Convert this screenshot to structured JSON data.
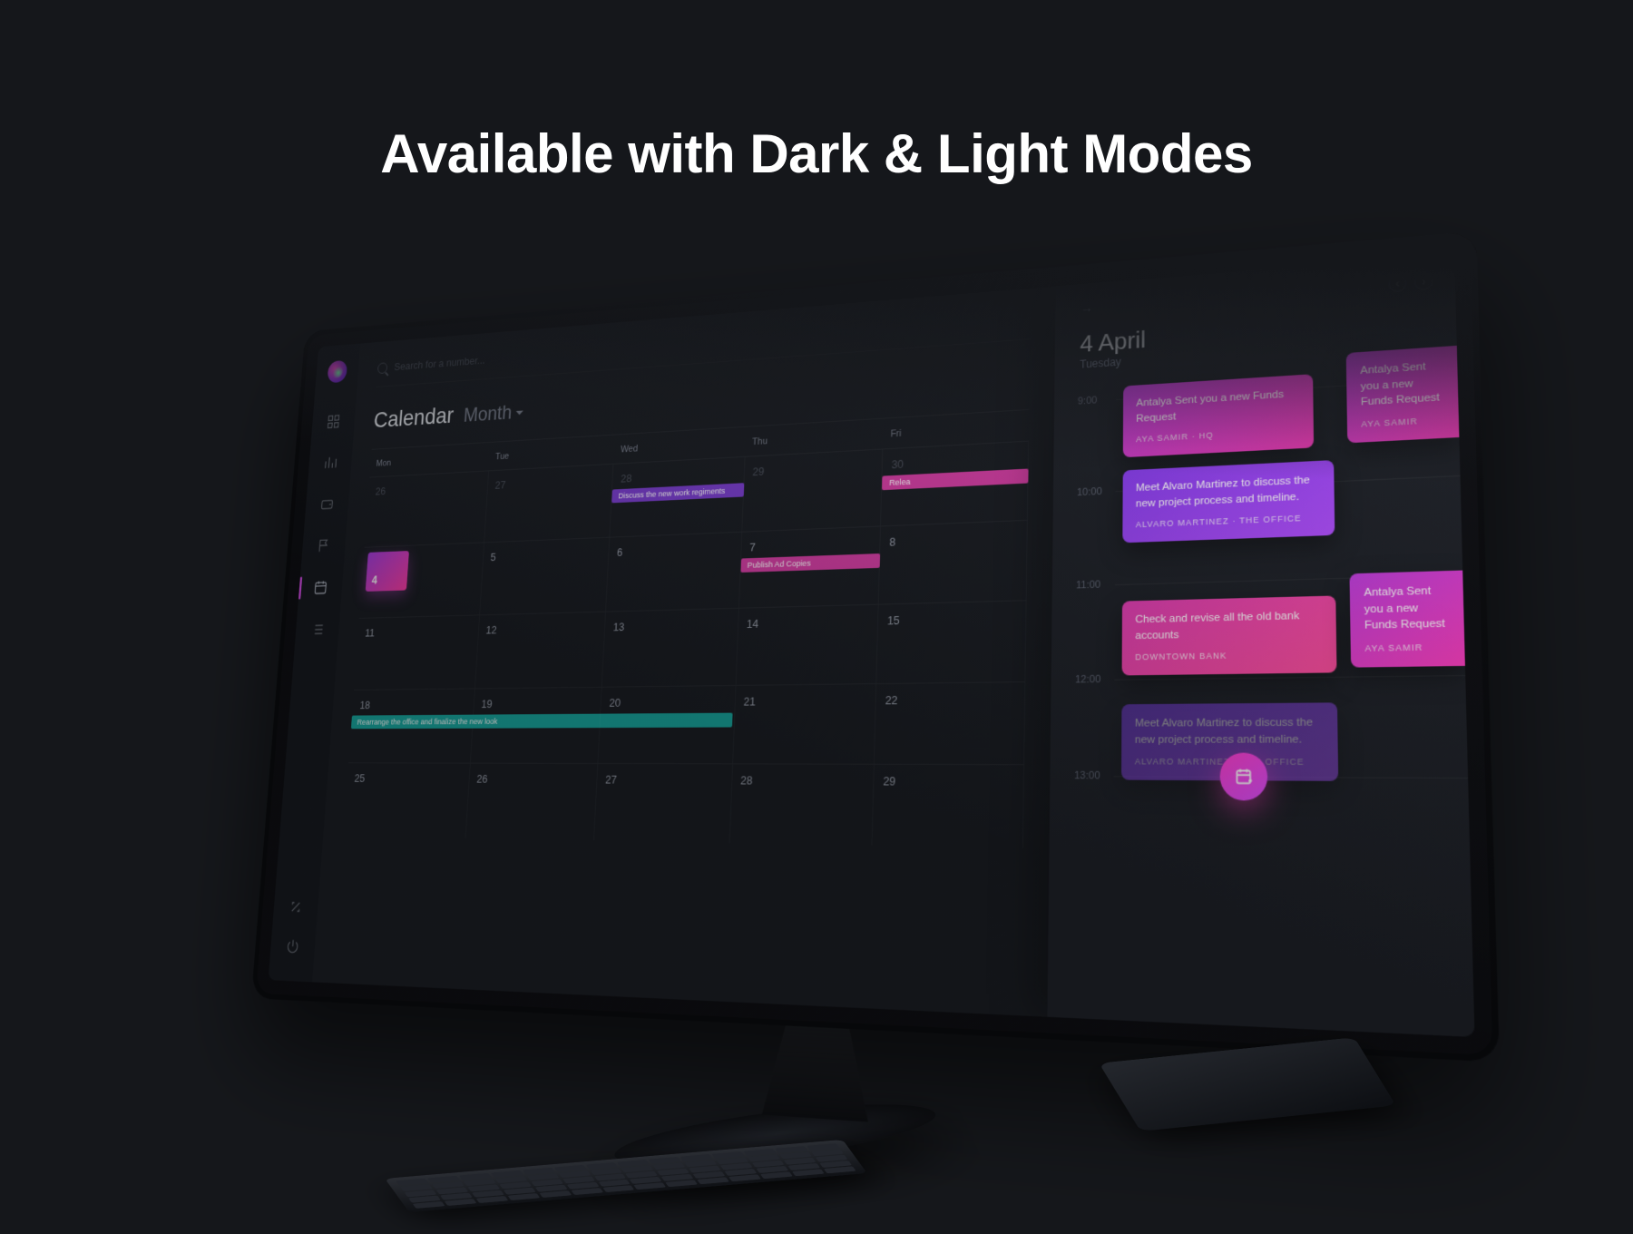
{
  "hero": {
    "title": "Available with Dark & Light Modes"
  },
  "search": {
    "placeholder": "Search for a number..."
  },
  "calendar": {
    "title": "Calendar",
    "view": "Month",
    "dow": [
      "Mon",
      "Tue",
      "Wed",
      "Thu",
      "Fri"
    ],
    "rows": [
      [
        "26",
        "27",
        "28",
        "29",
        "30"
      ],
      [
        "4",
        "5",
        "6",
        "7",
        "8"
      ],
      [
        "11",
        "12",
        "13",
        "14",
        "15"
      ],
      [
        "18",
        "19",
        "20",
        "21",
        "22"
      ],
      [
        "25",
        "26",
        "27",
        "28",
        "29"
      ]
    ],
    "today": "4",
    "events": {
      "row0_wed": {
        "label": "Discuss the new work regiments",
        "color": "purple"
      },
      "row0_fri": {
        "label": "Relea",
        "color": "pink"
      },
      "row1_thu": {
        "label": "Publish Ad Copies",
        "color": "pink"
      },
      "row3_mon": {
        "label": "Rearrange the office and finalize the new look",
        "color": "teal"
      }
    }
  },
  "agenda": {
    "date_big": "4 April",
    "date_sub": "Tuesday",
    "hours": [
      "9:00",
      "10:00",
      "11:00",
      "12:00",
      "13:00"
    ],
    "cards": [
      {
        "title": "Antalya Sent you a new Funds Request",
        "meta": "AYA SAMIR · HQ"
      },
      {
        "title": "Antalya Sent you a new Funds Request",
        "meta": "AYA SAMIR"
      },
      {
        "title": "Meet Alvaro Martinez to discuss the new project process and timeline.",
        "meta": "ALVARO MARTINEZ · THE OFFICE"
      },
      {
        "title": "Check and revise all the old bank accounts",
        "meta": "DOWNTOWN BANK"
      },
      {
        "title": "Antalya Sent you a new Funds Request",
        "meta": "AYA SAMIR"
      },
      {
        "title": "Meet Alvaro Martinez to discuss the new project process and timeline.",
        "meta": "ALVARO MARTINEZ · THE OFFICE"
      }
    ]
  }
}
